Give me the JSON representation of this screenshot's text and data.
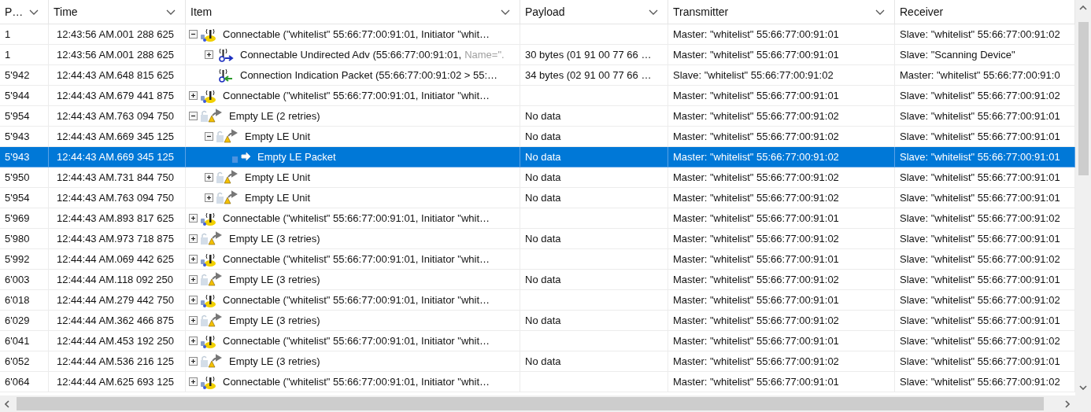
{
  "columns": [
    "P…",
    "Time",
    "Item",
    "Payload",
    "Transmitter",
    "Receiver"
  ],
  "rows": [
    {
      "p": "1",
      "time": "12:43:56 AM.001 288 625",
      "kind": "connectable",
      "item": "Connectable (\"whitelist\" 55:66:77:00:91:01, Initiator \"whit…",
      "payload": "",
      "transmitter": "Master: \"whitelist\" 55:66:77:00:91:01",
      "receiver": "Slave: \"whitelist\" 55:66:77:00:91:02",
      "expanded": true,
      "selected": false,
      "children": [
        {
          "p": "1",
          "time": "12:43:56 AM.001 288 625",
          "kind": "advertising",
          "item": "Connectable Undirected Adv (55:66:77:00:91:01,",
          "detail": "Name=\".",
          "payload": "30 bytes (01 91 00 77 66 …",
          "transmitter": "Master: \"whitelist\" 55:66:77:00:91:01",
          "receiver": "Slave: \"Scanning Device\"",
          "expanded": false,
          "selected": false
        },
        {
          "p": "5'942",
          "time": "12:44:43 AM.648 815 625",
          "kind": "indication",
          "item": "Connection Indication Packet (55:66:77:00:91:02 > 55:…",
          "payload": "34 bytes (02 91 00 77 66 …",
          "transmitter": "Slave: \"whitelist\" 55:66:77:00:91:02",
          "receiver": "Master: \"whitelist\" 55:66:77:00:91:0",
          "selected": false
        }
      ]
    },
    {
      "p": "5'944",
      "time": "12:44:43 AM.679 441 875",
      "kind": "connectable",
      "item": "Connectable (\"whitelist\" 55:66:77:00:91:01, Initiator \"whit…",
      "payload": "",
      "transmitter": "Master: \"whitelist\" 55:66:77:00:91:01",
      "receiver": "Slave: \"whitelist\" 55:66:77:00:91:02",
      "expanded": false,
      "selected": false
    },
    {
      "p": "5'954",
      "time": "12:44:43 AM.763 094 750",
      "kind": "empty",
      "item": "Empty LE (2 retries)",
      "payload": "No data",
      "transmitter": "Master: \"whitelist\" 55:66:77:00:91:02",
      "receiver": "Slave: \"whitelist\" 55:66:77:00:91:01",
      "expanded": true,
      "selected": false,
      "children": [
        {
          "p": "5'943",
          "time": "12:44:43 AM.669 345 125",
          "kind": "empty",
          "item": "Empty LE Unit",
          "payload": "No data",
          "transmitter": "Master: \"whitelist\" 55:66:77:00:91:02",
          "receiver": "Slave: \"whitelist\" 55:66:77:00:91:01",
          "expanded": true,
          "selected": false,
          "children": [
            {
              "p": "5'943",
              "time": "12:44:43 AM.669 345 125",
              "kind": "packet",
              "item": "Empty LE Packet",
              "payload": "No data",
              "transmitter": "Master: \"whitelist\" 55:66:77:00:91:02",
              "receiver": "Slave: \"whitelist\" 55:66:77:00:91:01",
              "selected": true
            }
          ]
        },
        {
          "p": "5'950",
          "time": "12:44:43 AM.731 844 750",
          "kind": "empty",
          "item": "Empty LE Unit",
          "payload": "No data",
          "transmitter": "Master: \"whitelist\" 55:66:77:00:91:02",
          "receiver": "Slave: \"whitelist\" 55:66:77:00:91:01",
          "expanded": false,
          "selected": false
        },
        {
          "p": "5'954",
          "time": "12:44:43 AM.763 094 750",
          "kind": "empty",
          "item": "Empty LE Unit",
          "payload": "No data",
          "transmitter": "Master: \"whitelist\" 55:66:77:00:91:02",
          "receiver": "Slave: \"whitelist\" 55:66:77:00:91:01",
          "expanded": false,
          "selected": false
        }
      ]
    },
    {
      "p": "5'969",
      "time": "12:44:43 AM.893 817 625",
      "kind": "connectable",
      "item": "Connectable (\"whitelist\" 55:66:77:00:91:01, Initiator \"whit…",
      "payload": "",
      "transmitter": "Master: \"whitelist\" 55:66:77:00:91:01",
      "receiver": "Slave: \"whitelist\" 55:66:77:00:91:02",
      "expanded": false,
      "selected": false
    },
    {
      "p": "5'980",
      "time": "12:44:43 AM.973 718 875",
      "kind": "empty",
      "item": "Empty LE (3 retries)",
      "payload": "No data",
      "transmitter": "Master: \"whitelist\" 55:66:77:00:91:02",
      "receiver": "Slave: \"whitelist\" 55:66:77:00:91:01",
      "expanded": false,
      "selected": false
    },
    {
      "p": "5'992",
      "time": "12:44:44 AM.069 442 625",
      "kind": "connectable",
      "item": "Connectable (\"whitelist\" 55:66:77:00:91:01, Initiator \"whit…",
      "payload": "",
      "transmitter": "Master: \"whitelist\" 55:66:77:00:91:01",
      "receiver": "Slave: \"whitelist\" 55:66:77:00:91:02",
      "expanded": false,
      "selected": false
    },
    {
      "p": "6'003",
      "time": "12:44:44 AM.118 092 250",
      "kind": "empty",
      "item": "Empty LE (3 retries)",
      "payload": "No data",
      "transmitter": "Master: \"whitelist\" 55:66:77:00:91:02",
      "receiver": "Slave: \"whitelist\" 55:66:77:00:91:01",
      "expanded": false,
      "selected": false
    },
    {
      "p": "6'018",
      "time": "12:44:44 AM.279 442 750",
      "kind": "connectable",
      "item": "Connectable (\"whitelist\" 55:66:77:00:91:01, Initiator \"whit…",
      "payload": "",
      "transmitter": "Master: \"whitelist\" 55:66:77:00:91:01",
      "receiver": "Slave: \"whitelist\" 55:66:77:00:91:02",
      "expanded": false,
      "selected": false
    },
    {
      "p": "6'029",
      "time": "12:44:44 AM.362 466 875",
      "kind": "empty",
      "item": "Empty LE (3 retries)",
      "payload": "No data",
      "transmitter": "Master: \"whitelist\" 55:66:77:00:91:02",
      "receiver": "Slave: \"whitelist\" 55:66:77:00:91:01",
      "expanded": false,
      "selected": false
    },
    {
      "p": "6'041",
      "time": "12:44:44 AM.453 192 250",
      "kind": "connectable",
      "item": "Connectable (\"whitelist\" 55:66:77:00:91:01, Initiator \"whit…",
      "payload": "",
      "transmitter": "Master: \"whitelist\" 55:66:77:00:91:01",
      "receiver": "Slave: \"whitelist\" 55:66:77:00:91:02",
      "expanded": false,
      "selected": false
    },
    {
      "p": "6'052",
      "time": "12:44:44 AM.536 216 125",
      "kind": "empty",
      "item": "Empty LE (3 retries)",
      "payload": "No data",
      "transmitter": "Master: \"whitelist\" 55:66:77:00:91:02",
      "receiver": "Slave: \"whitelist\" 55:66:77:00:91:01",
      "expanded": false,
      "selected": false
    },
    {
      "p": "6'064",
      "time": "12:44:44 AM.625 693 125",
      "kind": "connectable",
      "item": "Connectable (\"whitelist\" 55:66:77:00:91:01, Initiator \"whit…",
      "payload": "",
      "transmitter": "Master: \"whitelist\" 55:66:77:00:91:01",
      "receiver": "Slave: \"whitelist\" 55:66:77:00:91:02",
      "expanded": false,
      "selected": false
    }
  ]
}
